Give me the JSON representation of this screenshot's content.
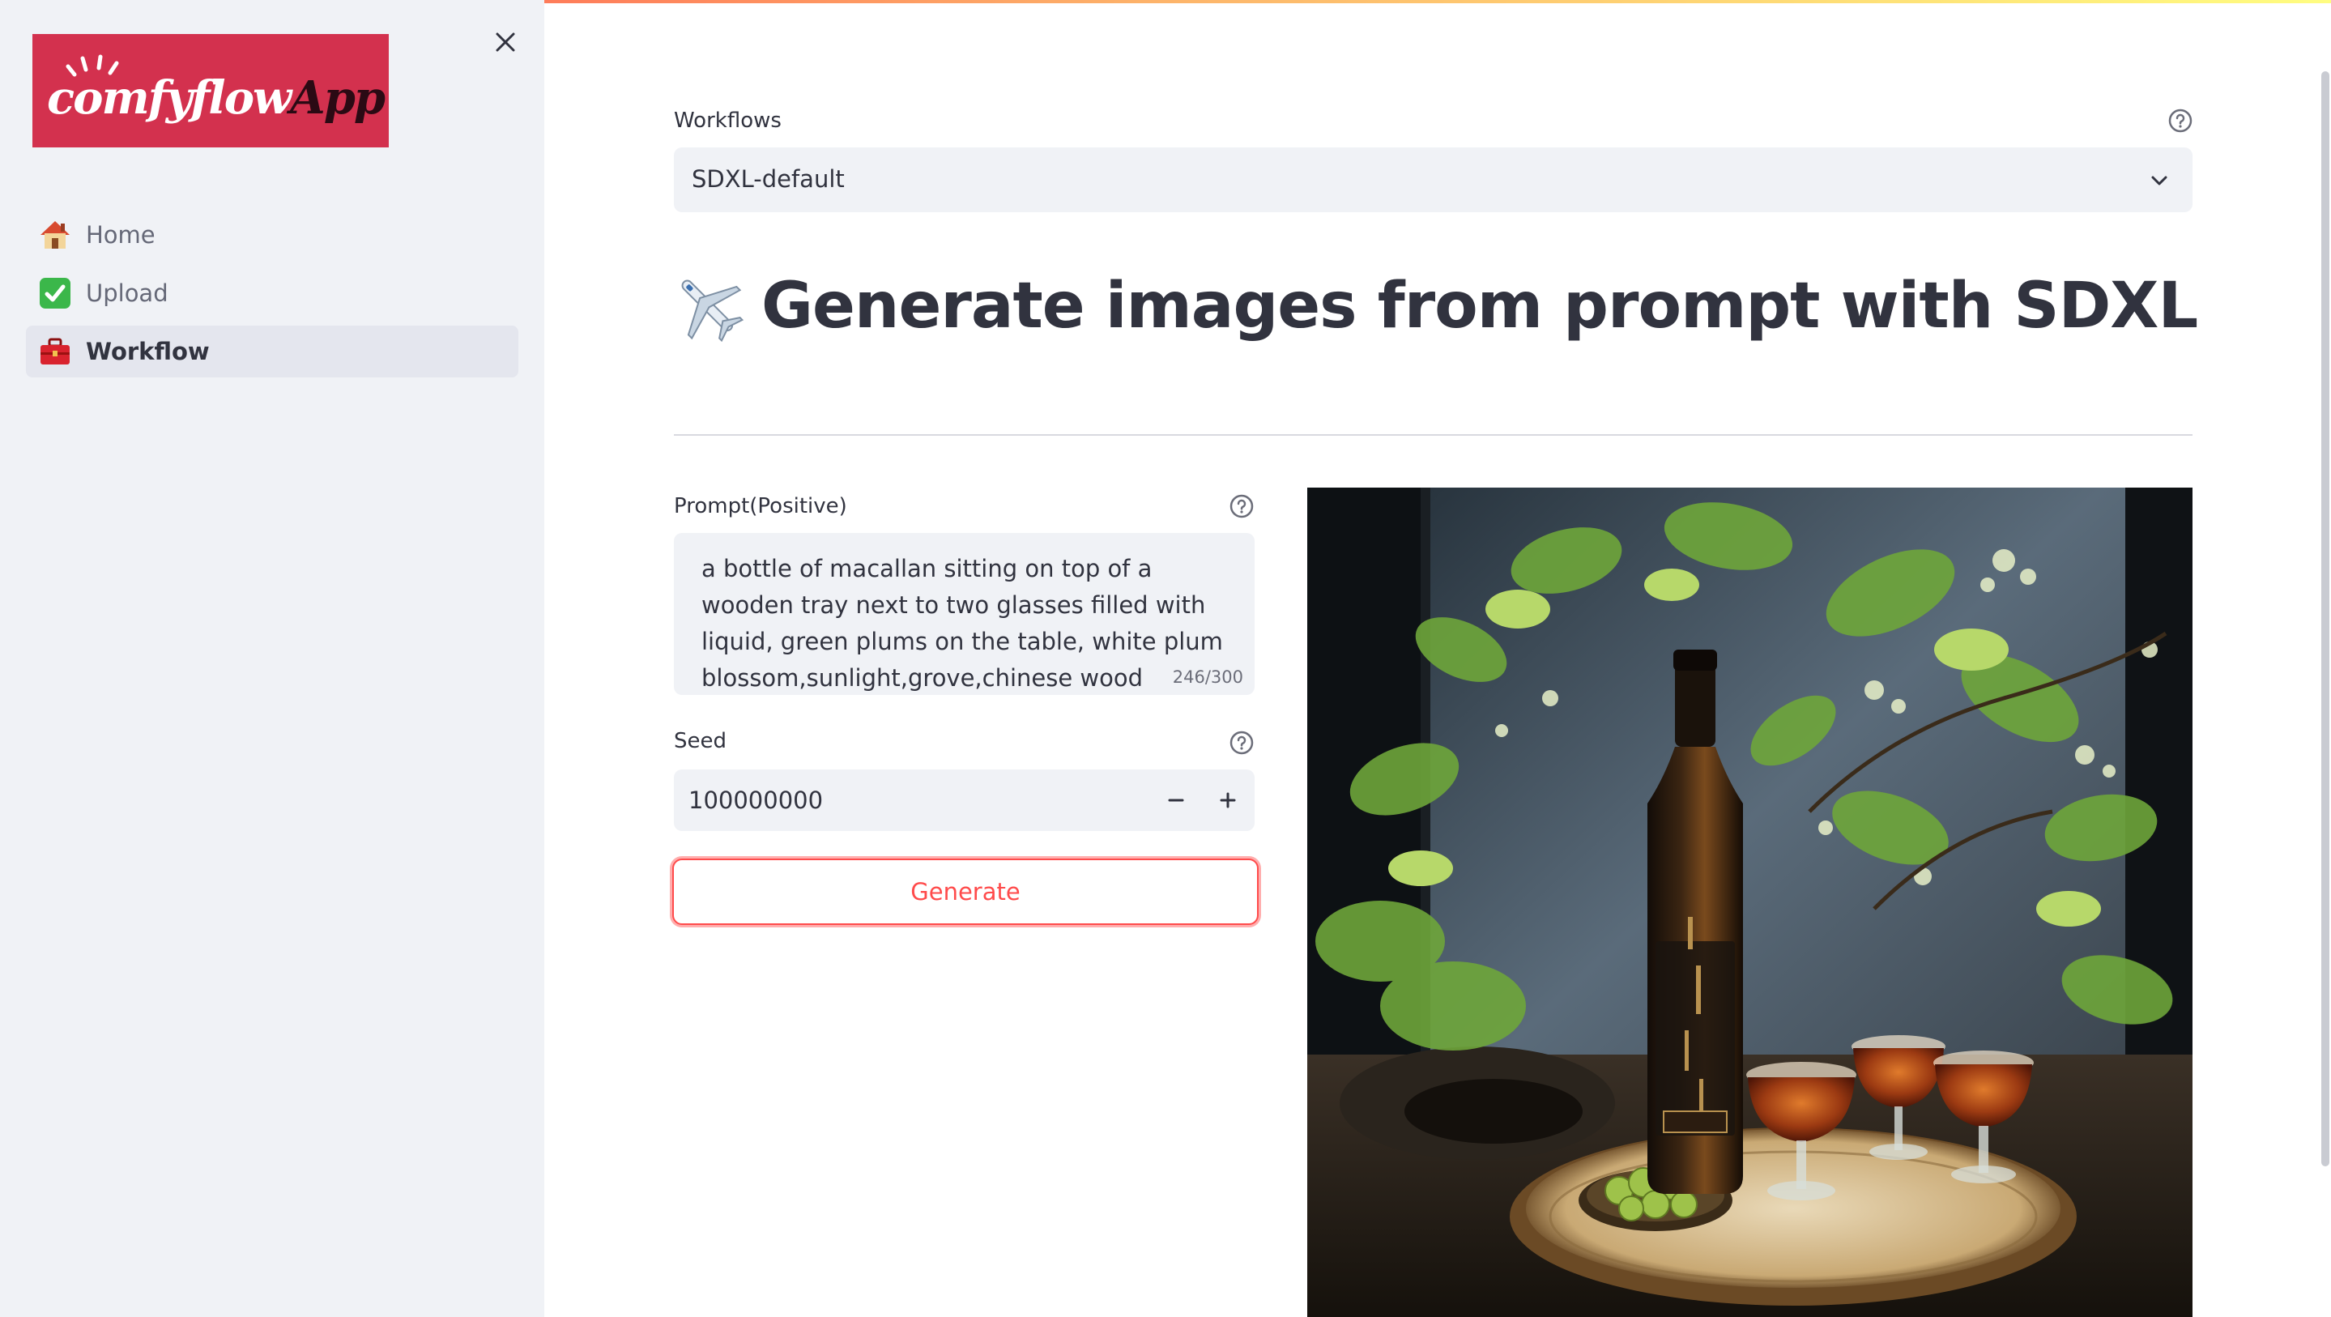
{
  "sidebar": {
    "logo_text_main": "comfyflow",
    "logo_text_app": "App",
    "items": [
      {
        "label": "Home",
        "icon": "house-icon",
        "active": false
      },
      {
        "label": "Upload",
        "icon": "check-box-icon",
        "active": false
      },
      {
        "label": "Workflow",
        "icon": "toolbox-icon",
        "active": true
      }
    ]
  },
  "main": {
    "workflows_label": "Workflows",
    "workflow_selected": "SDXL-default",
    "title": "Generate images from prompt with SDXL",
    "prompt_label": "Prompt(Positive)",
    "prompt_value": "a bottle of macallan sitting on top of a wooden tray next to two glasses filled with liquid,  green plums on the table,   white plum blossom,sunlight,grove,chinese wood",
    "prompt_counter": "246/300",
    "seed_label": "Seed",
    "seed_value": "100000000",
    "generate_label": "Generate"
  },
  "colors": {
    "accent": "#ff4b4b",
    "sidebar_bg": "#f0f2f6",
    "logo_bg": "#d3314e",
    "text": "#31333f"
  }
}
